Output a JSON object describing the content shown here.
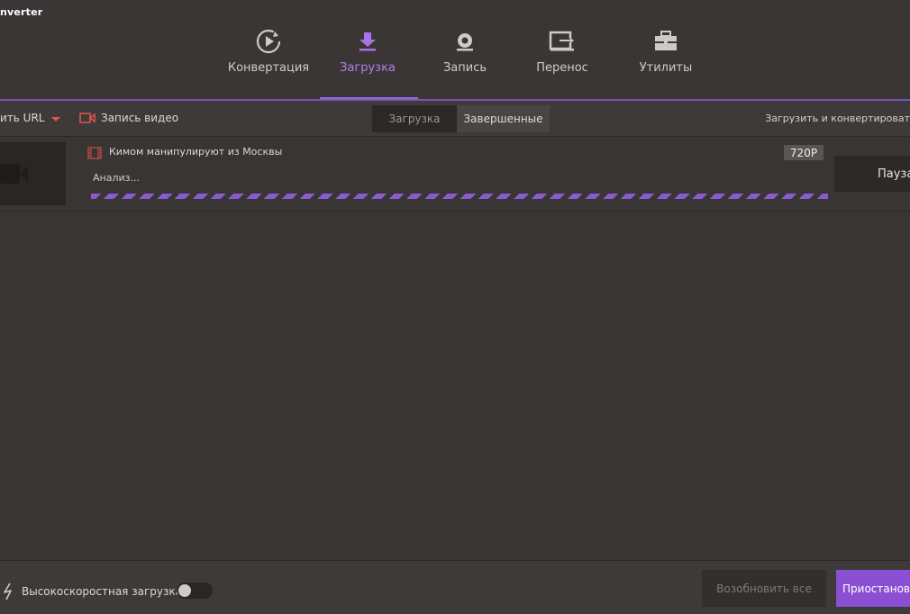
{
  "app": {
    "brand": "nverter"
  },
  "nav": {
    "tabs": [
      {
        "label": "Конвертация",
        "icon": "convert-icon"
      },
      {
        "label": "Загрузка",
        "icon": "download-icon",
        "active": true
      },
      {
        "label": "Запись",
        "icon": "record-icon"
      },
      {
        "label": "Перенос",
        "icon": "transfer-icon"
      },
      {
        "label": "Утилиты",
        "icon": "toolbox-icon"
      }
    ]
  },
  "toolbar": {
    "paste_url_label": "ить URL",
    "record_video_label": "Запись видео",
    "segment_downloading": "Загрузка",
    "segment_finished": "Завершенные",
    "download_convert_label": "Загрузить и конвертироват"
  },
  "item": {
    "title": " Кимом  манипулируют из Москвы",
    "quality": "720P",
    "status": "Анализ...",
    "pause_label": "Пауза"
  },
  "footer": {
    "high_speed_label": "Высокоскоростная загрузка",
    "high_speed_enabled": false,
    "resume_all_label": "Возобновить все",
    "pause_all_label": "Приостановить все"
  },
  "colors": {
    "accent": "#8a4fd2",
    "accent_text": "#b07fe0",
    "record_red": "#e0584a",
    "background": "#3a3535"
  }
}
